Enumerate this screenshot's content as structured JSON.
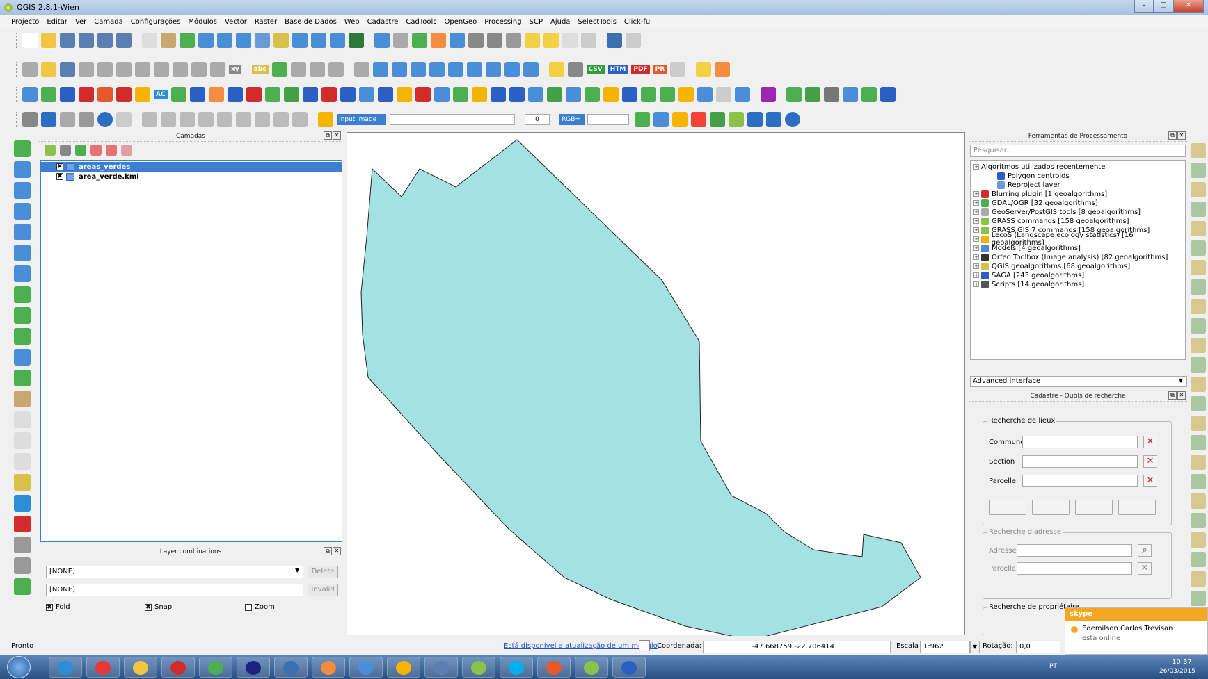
{
  "window": {
    "title": "QGIS 2.8.1-Wien"
  },
  "menu": [
    "Projecto",
    "Editar",
    "Ver",
    "Camada",
    "Configurações",
    "Módulos",
    "Vector",
    "Raster",
    "Base de Dados",
    "Web",
    "Cadastre",
    "CadTools",
    "OpenGeo",
    "Processing",
    "SCP",
    "Ajuda",
    "SelectTools",
    "Click-fu"
  ],
  "toolbar": {
    "abc": "abc",
    "xy": "xy",
    "csv": "CSV",
    "htm": "HTM",
    "pdf": "PDF",
    "pr": "PR",
    "ac": "AC",
    "input_image": "Input image",
    "rgb": "RGB=",
    "rotate_value": "0"
  },
  "layers": {
    "title": "Camadas",
    "items": [
      {
        "name": "areas_verdes",
        "checked": "✖"
      },
      {
        "name": "area_verde.kml",
        "checked": "✖"
      }
    ]
  },
  "combos": {
    "title": "Layer combinations",
    "combo1": "[NONE]",
    "delete": "Delete",
    "combo2": "[NONE]",
    "invalid": "Invalid",
    "fold": "Fold",
    "snap": "Snap",
    "zoom": "Zoom",
    "check_mark": "✖"
  },
  "processing": {
    "title": "Ferramentas de Processamento",
    "search_placeholder": "Pesquisar...",
    "recent": "Algoritmos utilizados recentemente",
    "recent_items": [
      "Polygon centroids",
      "Reproject layer"
    ],
    "providers": [
      "Blurring plugin [1 geoalgorithms]",
      "GDAL/OGR [32 geoalgorithms]",
      "GeoServer/PostGIS tools [8 geoalgorithms]",
      "GRASS commands [158 geoalgorithms]",
      "GRASS GIS 7 commands [158 geoalgorithms]",
      "LecoS (Landscape ecology statistics) [16 geoalgorithms]",
      "Models [4 geoalgorithms]",
      "Orfeo Toolbox (Image analysis) [82 geoalgorithms]",
      "QGIS geoalgorithms [68 geoalgorithms]",
      "SAGA [243 geoalgorithms]",
      "Scripts [14 geoalgorithms]"
    ],
    "interface": "Advanced interface"
  },
  "cadastre": {
    "title": "Cadastre - Outils de recherche",
    "lieux": "Recherche de lieux",
    "commune": "Commune",
    "section": "Section",
    "parcelle": "Parcelle",
    "adresse_group": "Recherche d'adresse",
    "adresse": "Adresse",
    "parcelle2": "Parcelle",
    "proprio": "Recherche de propriétaire"
  },
  "status": {
    "ready": "Pronto",
    "update": "Está disponível a atualização de um módulo",
    "coord_label": "Coordenada:",
    "coord": "-47.668759,-22.706414",
    "scale_label": "Escala",
    "scale": "1:962",
    "rot_label": "Rotação:",
    "rot": "0,0"
  },
  "skype": {
    "brand": "skype",
    "name": "Edemilson Carlos Trevisan",
    "state": "está online"
  },
  "taskbar": {
    "lang": "PT",
    "time": "10:37",
    "date": "26/03/2015"
  },
  "colors": {
    "polygon": "#a4e1e3",
    "selection": "#3c7fd0"
  }
}
